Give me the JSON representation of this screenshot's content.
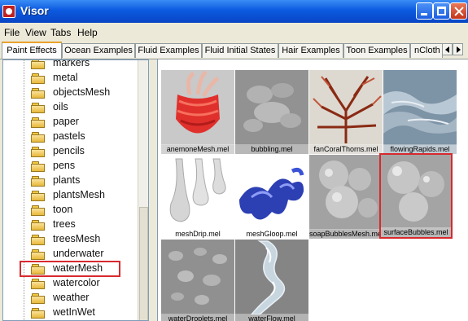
{
  "window": {
    "title": "Visor"
  },
  "menu": [
    "File",
    "View",
    "Tabs",
    "Help"
  ],
  "tabs": [
    "Paint Effects",
    "Ocean Examples",
    "Fluid Examples",
    "Fluid Initial States",
    "Hair Examples",
    "Toon Examples",
    "nCloth"
  ],
  "active_tab": "Paint Effects",
  "tree": {
    "items": [
      "markers",
      "metal",
      "objectsMesh",
      "oils",
      "paper",
      "pastels",
      "pencils",
      "pens",
      "plants",
      "plantsMesh",
      "toon",
      "trees",
      "treesMesh",
      "underwater",
      "waterMesh",
      "watercolor",
      "weather",
      "wetInWet"
    ],
    "selected": "waterMesh"
  },
  "thumbnails": [
    {
      "label": "anemoneMesh.mel",
      "icon": "anemone-mesh-icon"
    },
    {
      "label": "bubbling.mel",
      "icon": "bubbling-icon"
    },
    {
      "label": "fanCoralThorns.mel",
      "icon": "fan-coral-icon"
    },
    {
      "label": "flowingRapids.mel",
      "icon": "flowing-rapids-icon"
    },
    {
      "label": "meshDrip.mel",
      "icon": "mesh-drip-icon"
    },
    {
      "label": "meshGloop.mel",
      "icon": "mesh-gloop-icon"
    },
    {
      "label": "soapBubblesMesh.mel",
      "icon": "soap-bubbles-icon"
    },
    {
      "label": "surfaceBubbles.mel",
      "icon": "surface-bubbles-icon"
    },
    {
      "label": "waterDroplets.mel",
      "icon": "water-droplets-icon"
    },
    {
      "label": "waterFlow.mel",
      "icon": "water-flow-icon"
    }
  ],
  "selected_thumbnail": "surfaceBubbles.mel",
  "colors": {
    "titlebar": "#0c5ae0",
    "highlight": "#d8292e",
    "active_tab_accent": "#e8a32c"
  }
}
